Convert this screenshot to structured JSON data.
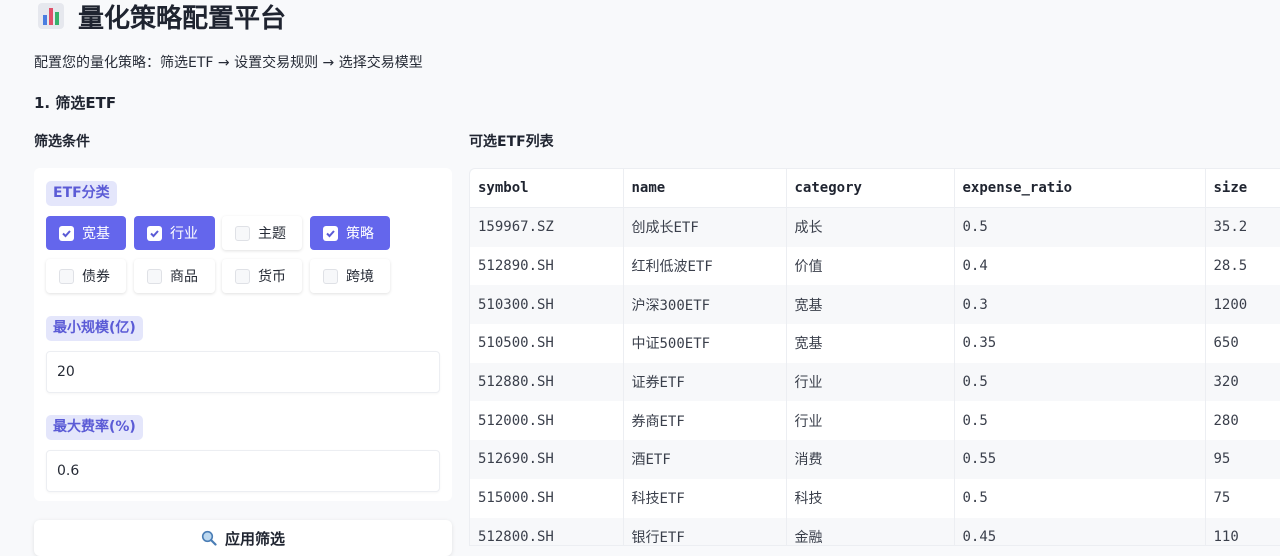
{
  "app": {
    "title": "量化策略配置平台",
    "subtitle": "配置您的量化策略：筛选ETF → 设置交易规则 → 选择交易模型"
  },
  "section": {
    "heading": "1. 筛选ETF"
  },
  "filters": {
    "heading": "筛选条件",
    "category_label": "ETF分类",
    "categories": [
      {
        "label": "宽基",
        "checked": true
      },
      {
        "label": "行业",
        "checked": true
      },
      {
        "label": "主题",
        "checked": false
      },
      {
        "label": "策略",
        "checked": true
      },
      {
        "label": "债券",
        "checked": false
      },
      {
        "label": "商品",
        "checked": false
      },
      {
        "label": "货币",
        "checked": false
      },
      {
        "label": "跨境",
        "checked": false
      }
    ],
    "min_size_label": "最小规模(亿)",
    "min_size_value": "20",
    "max_fee_label": "最大费率(%)",
    "max_fee_value": "0.6",
    "apply_label": "应用筛选"
  },
  "etf_table": {
    "heading": "可选ETF列表",
    "columns": [
      "symbol",
      "name",
      "category",
      "expense_ratio",
      "size"
    ],
    "rows": [
      [
        "159967.SZ",
        "创成长ETF",
        "成长",
        "0.5",
        "35.2"
      ],
      [
        "512890.SH",
        "红利低波ETF",
        "价值",
        "0.4",
        "28.5"
      ],
      [
        "510300.SH",
        "沪深300ETF",
        "宽基",
        "0.3",
        "1200"
      ],
      [
        "510500.SH",
        "中证500ETF",
        "宽基",
        "0.35",
        "650"
      ],
      [
        "512880.SH",
        "证券ETF",
        "行业",
        "0.5",
        "320"
      ],
      [
        "512000.SH",
        "券商ETF",
        "行业",
        "0.5",
        "280"
      ],
      [
        "512690.SH",
        "酒ETF",
        "消费",
        "0.55",
        "95"
      ],
      [
        "515000.SH",
        "科技ETF",
        "科技",
        "0.5",
        "75"
      ],
      [
        "512800.SH",
        "银行ETF",
        "金融",
        "0.45",
        "110"
      ]
    ]
  },
  "colors": {
    "accent": "#6466ec",
    "pill_bg": "#e4e6fb",
    "pill_text": "#5b5bd6"
  }
}
